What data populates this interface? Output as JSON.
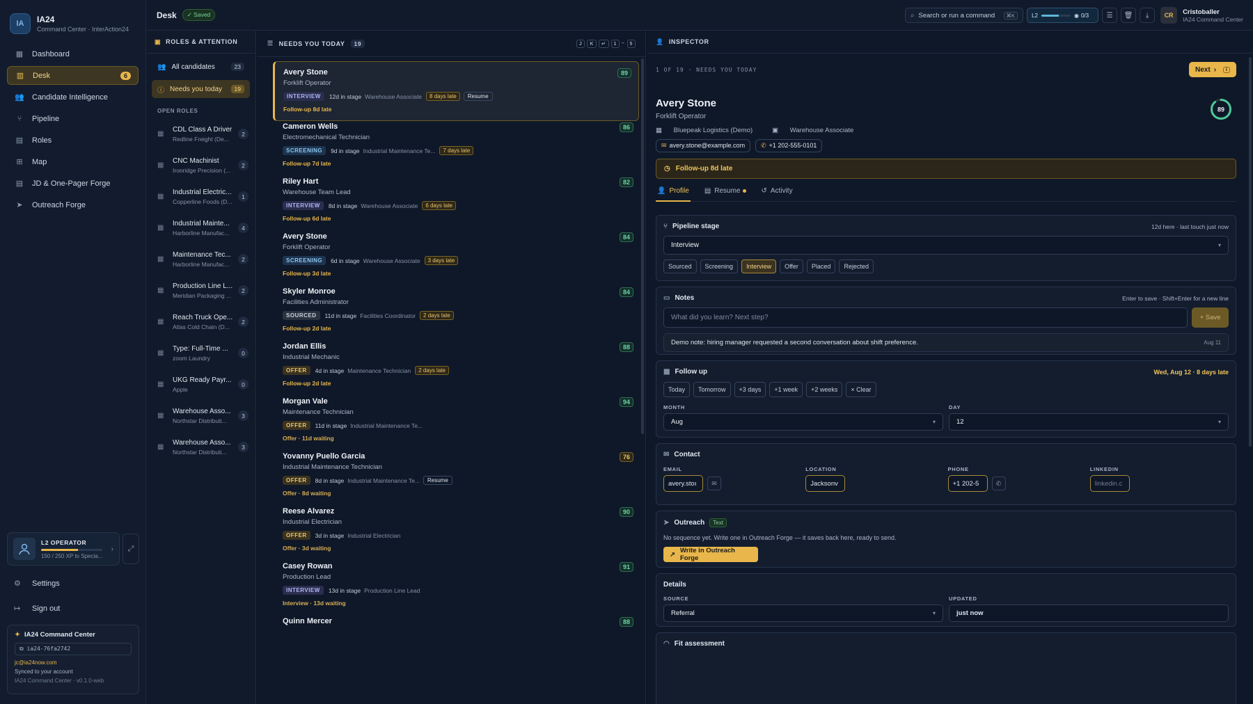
{
  "brand": {
    "logo": "IA",
    "name": "IA24",
    "subtitle": "Command Center · InterAction24"
  },
  "nav": [
    {
      "label": "Dashboard",
      "icon": "dashboard-icon"
    },
    {
      "label": "Desk",
      "icon": "desk-icon",
      "badge": "6",
      "active": true
    },
    {
      "label": "Candidate Intelligence",
      "icon": "users-icon"
    },
    {
      "label": "Pipeline",
      "icon": "branch-icon"
    },
    {
      "label": "Roles",
      "icon": "building-icon"
    },
    {
      "label": "Map",
      "icon": "map-icon"
    },
    {
      "label": "JD & One-Pager Forge",
      "icon": "document-icon"
    },
    {
      "label": "Outreach Forge",
      "icon": "send-icon"
    }
  ],
  "operator": {
    "title": "L2 OPERATOR",
    "xp_fraction": 0.6,
    "sub": "150 / 250 XP to Specia..."
  },
  "side_links": {
    "settings": "Settings",
    "signout": "Sign out"
  },
  "account": {
    "title": "IA24 Command Center",
    "id": "ia24-76fa2742",
    "email": "jc@ia24now.com",
    "synced": "Synced to your account",
    "version": "IA24 Command Center · v0.1.0-web"
  },
  "topbar": {
    "title": "Desk",
    "saved": "✓ Saved",
    "search_placeholder": "Search or run a command",
    "search_kbd": "⌘K",
    "level": "L2",
    "level_progress": 0.6,
    "level_count": "0/3",
    "user_initials": "CR",
    "user_name": "Cristoballer",
    "user_sub": "IA24 Command Center"
  },
  "roles_panel": {
    "header": "ROLES & ATTENTION",
    "all": {
      "label": "All candidates",
      "count": "23"
    },
    "needs": {
      "label": "Needs you today",
      "count": "19"
    },
    "open_roles_label": "OPEN ROLES",
    "roles": [
      {
        "name": "CDL Class A Driver",
        "company": "Redline Freight (De...",
        "count": "2"
      },
      {
        "name": "CNC Machinist",
        "company": "Ironridge Precision (...",
        "count": "2"
      },
      {
        "name": "Industrial Electric...",
        "company": "Copperline Foods (D...",
        "count": "1"
      },
      {
        "name": "Industrial Mainte...",
        "company": "Harborline Manufac...",
        "count": "4"
      },
      {
        "name": "Maintenance Tec...",
        "company": "Harborline Manufac...",
        "count": "2"
      },
      {
        "name": "Production Line L...",
        "company": "Meridian Packaging ...",
        "count": "2"
      },
      {
        "name": "Reach Truck Ope...",
        "company": "Atlas Cold Chain (D...",
        "count": "2"
      },
      {
        "name": "Type: Full-Time ...",
        "company": "zoom Laundry",
        "count": "0"
      },
      {
        "name": "UKG Ready Payr...",
        "company": "Apple",
        "count": "0"
      },
      {
        "name": "Warehouse Asso...",
        "company": "Northstar Distributi...",
        "count": "3"
      },
      {
        "name": "Warehouse Asso...",
        "company": "Northstar Distributi...",
        "count": "3"
      }
    ]
  },
  "queue": {
    "header": "NEEDS YOU TODAY",
    "count": "19",
    "keys": [
      "J",
      "K",
      "↵",
      "1",
      "–",
      "5"
    ],
    "cards": [
      {
        "name": "Avery Stone",
        "title": "Forklift Operator",
        "stage": "INTERVIEW",
        "stage_class": "st-interview",
        "days": "12d in stage",
        "role": "Warehouse Associate",
        "late": "8 days late",
        "resume": "Resume",
        "foot": "Follow-up 8d late",
        "score": "89",
        "score_class": "sc-sel",
        "selected": true
      },
      {
        "name": "Cameron Wells",
        "title": "Electromechanical Technician",
        "stage": "SCREENING",
        "stage_class": "st-screening",
        "days": "9d in stage",
        "role": "Industrial Maintenance Te...",
        "late": "7 days late",
        "resume": "",
        "foot": "Follow-up 7d late",
        "score": "86",
        "score_class": "sc-g"
      },
      {
        "name": "Riley Hart",
        "title": "Warehouse Team Lead",
        "stage": "INTERVIEW",
        "stage_class": "st-interview",
        "days": "8d in stage",
        "role": "Warehouse Associate",
        "late": "6 days late",
        "resume": "",
        "foot": "Follow-up 6d late",
        "score": "82",
        "score_class": "sc-g"
      },
      {
        "name": "Avery Stone",
        "title": "Forklift Operator",
        "stage": "SCREENING",
        "stage_class": "st-screening",
        "days": "6d in stage",
        "role": "Warehouse Associate",
        "late": "3 days late",
        "resume": "",
        "foot": "Follow-up 3d late",
        "score": "84",
        "score_class": "sc-g"
      },
      {
        "name": "Skyler Monroe",
        "title": "Facilities Administrator",
        "stage": "SOURCED",
        "stage_class": "st-sourced",
        "days": "11d in stage",
        "role": "Facilities Coordinator",
        "late": "2 days late",
        "resume": "",
        "foot": "Follow-up 2d late",
        "score": "84",
        "score_class": "sc-g"
      },
      {
        "name": "Jordan Ellis",
        "title": "Industrial Mechanic",
        "stage": "OFFER",
        "stage_class": "st-offer",
        "days": "4d in stage",
        "role": "Maintenance Technician",
        "late": "2 days late",
        "resume": "",
        "foot": "Follow-up 2d late",
        "score": "88",
        "score_class": "sc-g"
      },
      {
        "name": "Morgan Vale",
        "title": "Maintenance Technician",
        "stage": "OFFER",
        "stage_class": "st-offer",
        "days": "11d in stage",
        "role": "Industrial Maintenance Te...",
        "late": "",
        "resume": "",
        "foot": "Offer · 11d waiting",
        "score": "94",
        "score_class": "sc-g",
        "wait": true
      },
      {
        "name": "Yovanny Puello Garcia",
        "title": "Industrial Maintenance Technician",
        "stage": "OFFER",
        "stage_class": "st-offer",
        "days": "8d in stage",
        "role": "Industrial Maintenance Te...",
        "late": "",
        "resume": "Resume",
        "foot": "Offer · 8d waiting",
        "score": "76",
        "score_class": "sc-y",
        "wait": true
      },
      {
        "name": "Reese Alvarez",
        "title": "Industrial Electrician",
        "stage": "OFFER",
        "stage_class": "st-offer",
        "days": "3d in stage",
        "role": "Industrial Electrician",
        "late": "",
        "resume": "",
        "foot": "Offer · 3d waiting",
        "score": "90",
        "score_class": "sc-g",
        "wait": true
      },
      {
        "name": "Casey Rowan",
        "title": "Production Lead",
        "stage": "INTERVIEW",
        "stage_class": "st-interview",
        "days": "13d in stage",
        "role": "Production Line Lead",
        "late": "",
        "resume": "",
        "foot": "Interview · 13d waiting",
        "score": "91",
        "score_class": "sc-g",
        "wait": true
      },
      {
        "name": "Quinn Mercer",
        "title": "",
        "stage": "",
        "stage_class": "",
        "days": "",
        "role": "",
        "late": "",
        "resume": "",
        "foot": "",
        "score": "88",
        "score_class": "sc-g"
      }
    ]
  },
  "inspector": {
    "header": "INSPECTOR",
    "position": "1 OF 19 · NEEDS YOU TODAY",
    "next": "Next",
    "next_kbd": "›",
    "name": "Avery Stone",
    "title": "Forklift Operator",
    "company": "Bluepeak Logistics (Demo)",
    "role": "Warehouse Associate",
    "email": "avery.stone@example.com",
    "phone": "+1 202-555-0101",
    "score": "89",
    "score_fraction": 0.89,
    "followup_banner": "Follow-up 8d late",
    "tabs": [
      "Profile",
      "Resume",
      "Activity"
    ],
    "pipeline": {
      "label": "Pipeline stage",
      "hint": "12d here · last touch just now",
      "value": "Interview",
      "stages": [
        "Sourced",
        "Screening",
        "Interview",
        "Offer",
        "Placed",
        "Rejected"
      ],
      "active": "Interview"
    },
    "notes": {
      "label": "Notes",
      "hint": "Enter to save · Shift+Enter for a new line",
      "placeholder": "What did you learn? Next step?",
      "save": "+ Save",
      "item": "Demo note: hiring manager requested a second conversation about shift preference.",
      "item_date": "Aug 11"
    },
    "followup": {
      "label": "Follow up",
      "date": "Wed, Aug 12 · 8 days late",
      "quick": [
        "Today",
        "Tomorrow",
        "+3 days",
        "+1 week",
        "+2 weeks",
        "× Clear"
      ],
      "month_label": "MONTH",
      "month": "Aug",
      "day_label": "DAY",
      "day": "12"
    },
    "contact": {
      "label": "Contact",
      "email_label": "EMAIL",
      "email": "avery.stoı",
      "location_label": "LOCATION",
      "location": "Jacksonv",
      "phone_label": "PHONE",
      "phone": "+1 202-5",
      "linkedin_label": "LINKEDIN",
      "linkedin_placeholder": "linkedin.c"
    },
    "outreach": {
      "label": "Outreach",
      "badge": "Text",
      "sub": "No sequence yet. Write one in Outreach Forge — it saves back here, ready to send.",
      "button": "Write in Outreach Forge"
    },
    "details": {
      "label": "Details",
      "source_label": "SOURCE",
      "source": "Referral",
      "updated_label": "UPDATED",
      "updated": "just now"
    },
    "fit": {
      "label": "Fit assessment"
    }
  }
}
